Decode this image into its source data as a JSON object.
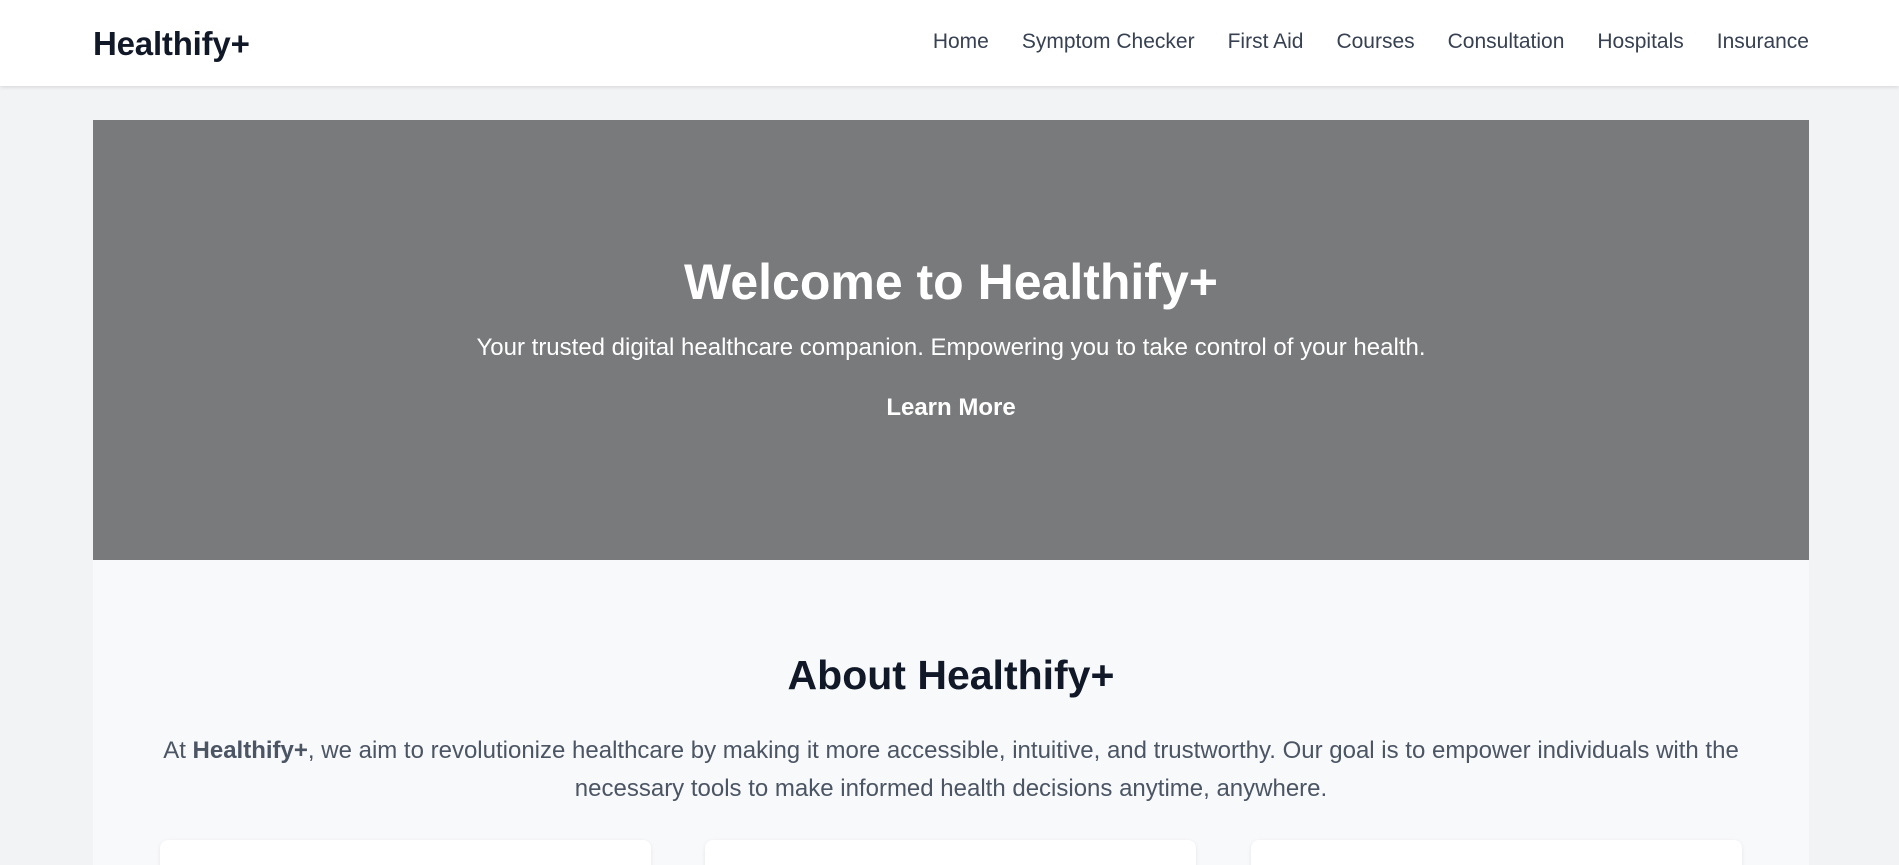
{
  "header": {
    "brand": "Healthify+",
    "nav": [
      "Home",
      "Symptom Checker",
      "First Aid",
      "Courses",
      "Consultation",
      "Hospitals",
      "Insurance"
    ]
  },
  "hero": {
    "title": "Welcome to Healthify+",
    "subtitle": "Your trusted digital healthcare companion. Empowering you to take control of your health.",
    "button_label": "Learn More"
  },
  "about": {
    "title": "About Healthify+",
    "text_before": "At ",
    "text_bold": "Healthify+",
    "text_after": ", we aim to revolutionize healthcare by making it more accessible, intuitive, and trustworthy. Our goal is to empower individuals with the necessary tools to make informed health decisions anytime, anywhere."
  },
  "colors": {
    "hero_bg": "#797a7c",
    "page_bg": "#f2f3f5",
    "text_dark": "#111827"
  }
}
